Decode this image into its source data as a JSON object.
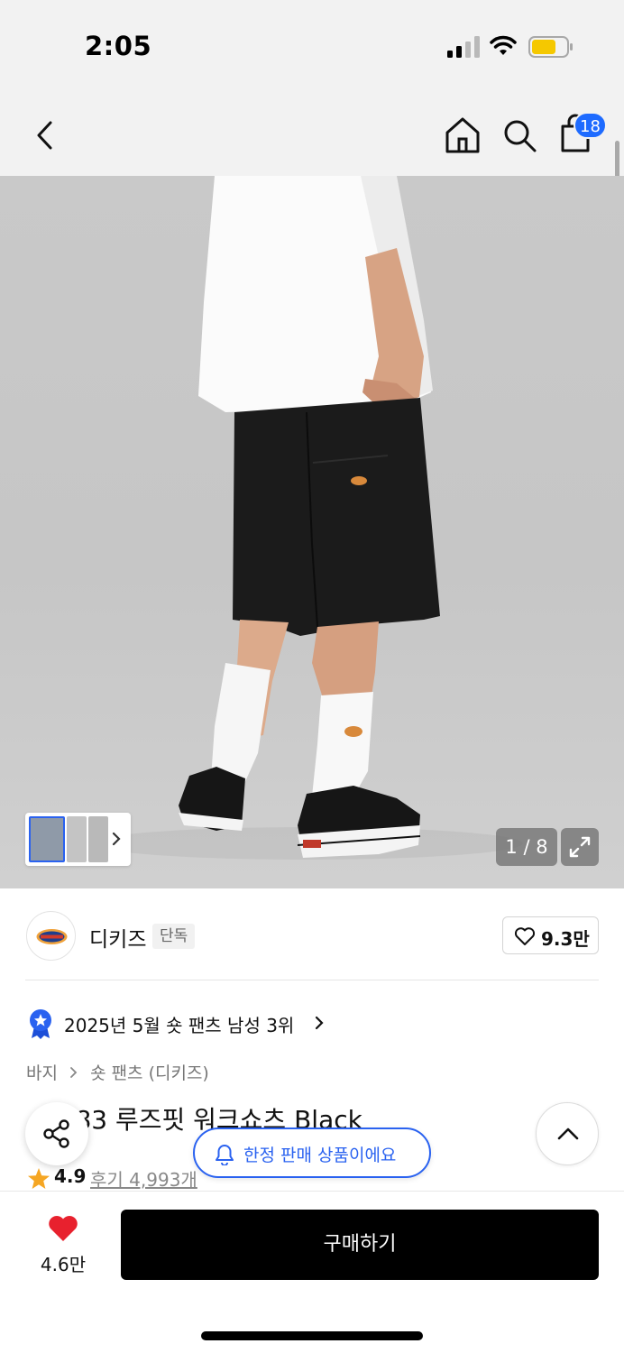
{
  "status_bar": {
    "time": "2:05"
  },
  "nav": {
    "cart_count": "18"
  },
  "gallery": {
    "page_counter": "1 / 8"
  },
  "brand": {
    "name": "디키즈",
    "tag": "단독",
    "likes": "9.3만"
  },
  "ranking": {
    "text": "2025년 5월 숏 팬츠 남성 3위"
  },
  "breadcrumb": {
    "level1": "바지",
    "level2": "숏 팬츠 (디키즈)"
  },
  "product": {
    "title": "42283 루즈핏 워크쇼츠 Black",
    "rating": "4.9",
    "review_label": "후기 4,993개"
  },
  "limited_banner": {
    "text": "한정 판매 상품이에요"
  },
  "bottom_bar": {
    "wish_count": "4.6만",
    "buy_label": "구매하기"
  },
  "colors": {
    "accent_blue": "#2a62f0",
    "badge_blue": "#1e6bff",
    "heart_red": "#e8212e",
    "star_orange": "#f5a623",
    "buy_black": "#000000"
  }
}
